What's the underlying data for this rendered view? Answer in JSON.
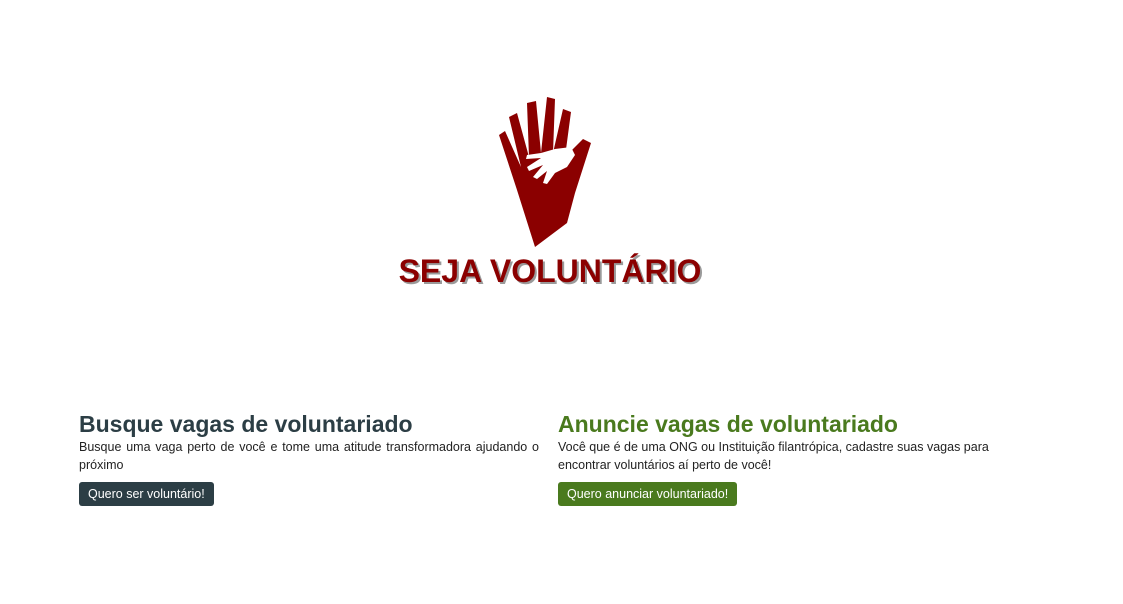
{
  "logo": {
    "text": "SEJA VOLUNTÁRIO",
    "icon": "helping-hands-icon",
    "color": "#8b0000"
  },
  "volunteer": {
    "title": "Busque vagas de voluntariado",
    "description": "Busque uma vaga perto de você e tome uma atitude transformadora ajudando o próximo",
    "button_label": "Quero ser voluntário!",
    "color": "#2c3e45"
  },
  "organization": {
    "title": "Anuncie vagas de voluntariado",
    "description": "Você que é de uma ONG ou Instituição filantrópica, cadastre suas vagas para encontrar voluntários aí perto de você!",
    "button_label": "Quero anunciar voluntariado!",
    "color": "#4a7a1e"
  }
}
